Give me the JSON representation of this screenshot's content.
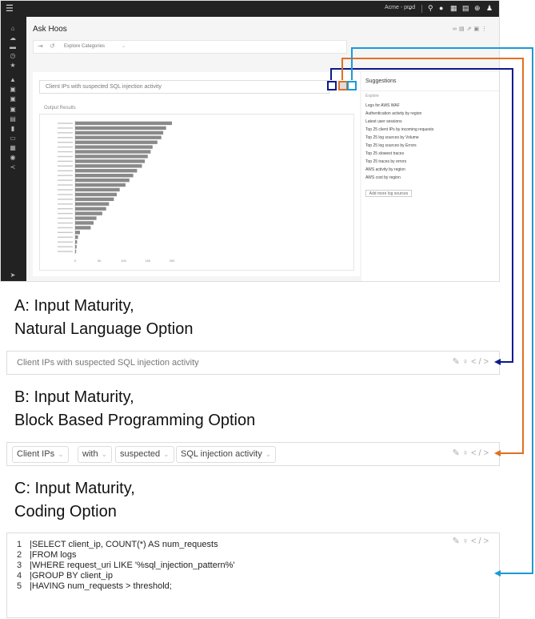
{
  "app": {
    "title": "Ask Hoos",
    "env_label": "Acme - prod",
    "toolbar": {
      "category_placeholder": "Explore Categories"
    },
    "query_text": "Client IPs with suspected SQL injection activity",
    "output_label": "Output Results",
    "suggestions": {
      "title": "Suggestions",
      "section": "Explore",
      "items": [
        "Logs for AWS WAF",
        "Authentication activity by region",
        "Latest user sessions",
        "Top 25 client IPs by incoming requests",
        "Top 25 log sources by Volume",
        "Top 25 log sources by Errors",
        "Top 25 slowest traces",
        "Top 25 traces by errors",
        "AWS activity by region",
        "AWS cost by region"
      ],
      "add_button": "Add more log sources"
    }
  },
  "captions": {
    "a_line1": "A: Input Maturity,",
    "a_line2": "Natural Language Option",
    "b_line1": "B: Input Maturity,",
    "b_line2": "Block Based Programming Option",
    "c_line1": "C: Input Maturity,",
    "c_line2": "Coding Option"
  },
  "natural_language": {
    "query": "Client IPs with suspected SQL injection activity"
  },
  "block_based": {
    "chips": [
      "Client IPs",
      "with",
      "suspected",
      "SQL injection activity"
    ]
  },
  "coding": {
    "lines": [
      {
        "num": "1",
        "text": "|SELECT client_ip, COUNT(*) AS num_requests"
      },
      {
        "num": "2",
        "text": "|FROM logs"
      },
      {
        "num": "3",
        "text": "|WHERE request_uri LIKE '%sql_injection_pattern%'"
      },
      {
        "num": "4",
        "text": "|GROUP BY client_ip"
      },
      {
        "num": "5",
        "text": "|HAVING num_requests > threshold;"
      }
    ]
  },
  "colors": {
    "a": "#0a1a8c",
    "b": "#e07020",
    "c": "#1a9ad6",
    "bar": "#8a8a8a"
  },
  "chart_data": {
    "type": "bar",
    "orientation": "horizontal",
    "values": [
      200,
      188,
      182,
      178,
      170,
      160,
      156,
      150,
      144,
      138,
      128,
      120,
      112,
      104,
      92,
      86,
      80,
      70,
      64,
      56,
      44,
      38,
      32,
      10,
      6,
      4,
      3,
      2
    ],
    "xlim": [
      0,
      200
    ],
    "xticks": [
      0,
      50,
      100,
      150,
      200
    ]
  }
}
